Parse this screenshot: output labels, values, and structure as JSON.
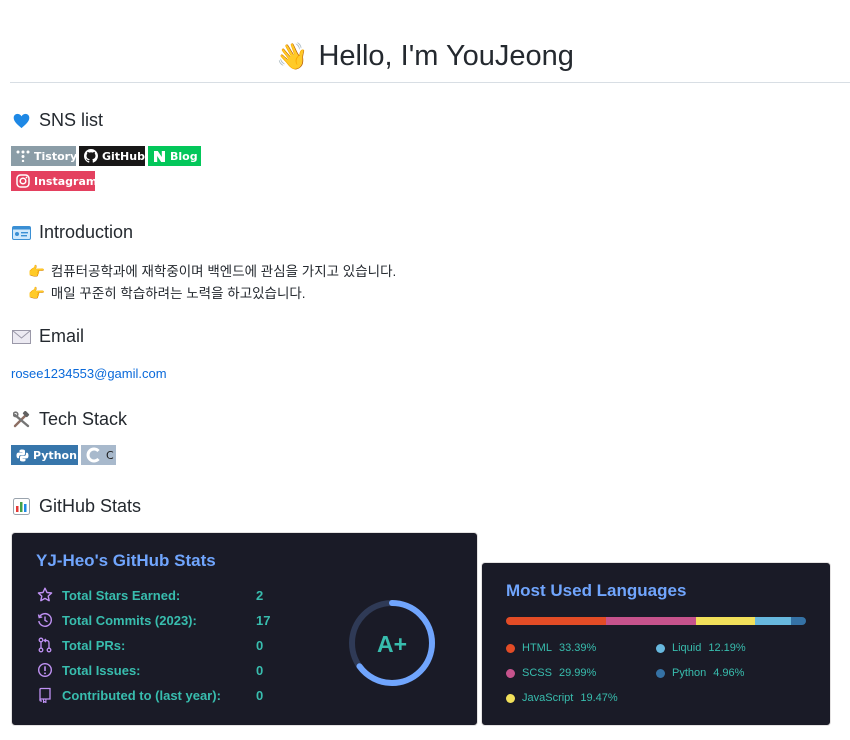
{
  "title": {
    "emoji": "👋",
    "text": "Hello, I'm YouJeong"
  },
  "sns": {
    "heading": "SNS list",
    "badges": [
      {
        "label": "Tistory",
        "color": "#8b9da7",
        "icon": "tistory-icon"
      },
      {
        "label": "GitHub",
        "color": "#181717",
        "icon": "github-icon"
      },
      {
        "label": "Blog",
        "color": "#03c75a",
        "icon": "naver-icon"
      },
      {
        "label": "Instagram",
        "color": "#e4405f",
        "icon": "instagram-icon"
      }
    ]
  },
  "intro": {
    "heading": "Introduction",
    "lines": [
      "컴퓨터공학과에 재학중이며 백엔드에 관심을 가지고 있습니다.",
      "매일 꾸준히 학습하려는 노력을 하고있습니다."
    ]
  },
  "email": {
    "heading": "Email",
    "address": "rosee1234553@gamil.com"
  },
  "tech": {
    "heading": "Tech Stack",
    "badges": [
      {
        "label": "Python",
        "color": "#3776ab",
        "icon": "python-icon"
      },
      {
        "label": "C",
        "color": "#a8b9cc",
        "icon": "c-icon"
      }
    ]
  },
  "github": {
    "heading": "GitHub Stats",
    "stats": {
      "title": "YJ-Heo's GitHub Stats",
      "rows": [
        {
          "label": "Total Stars Earned:",
          "value": "2",
          "icon": "star-icon"
        },
        {
          "label": "Total Commits (2023):",
          "value": "17",
          "icon": "history-icon"
        },
        {
          "label": "Total PRs:",
          "value": "0",
          "icon": "pull-request-icon"
        },
        {
          "label": "Total Issues:",
          "value": "0",
          "icon": "issue-icon"
        },
        {
          "label": "Contributed to (last year):",
          "value": "0",
          "icon": "repo-icon"
        }
      ],
      "grade": "A+",
      "grade_progress": 0.65
    },
    "languages": {
      "title": "Most Used Languages",
      "items": [
        {
          "name": "HTML",
          "percent": 33.39,
          "color": "#e34c26"
        },
        {
          "name": "SCSS",
          "percent": 29.99,
          "color": "#c6538c"
        },
        {
          "name": "JavaScript",
          "percent": 19.47,
          "color": "#f1e05a"
        },
        {
          "name": "Liquid",
          "percent": 12.19,
          "color": "#67b8de"
        },
        {
          "name": "Python",
          "percent": 4.96,
          "color": "#3572a5"
        }
      ]
    }
  },
  "colors": {
    "card_bg": "#1a1b27",
    "accent_blue": "#70a5fd",
    "accent_teal": "#38bdae",
    "icon_purple": "#bf91f3"
  }
}
